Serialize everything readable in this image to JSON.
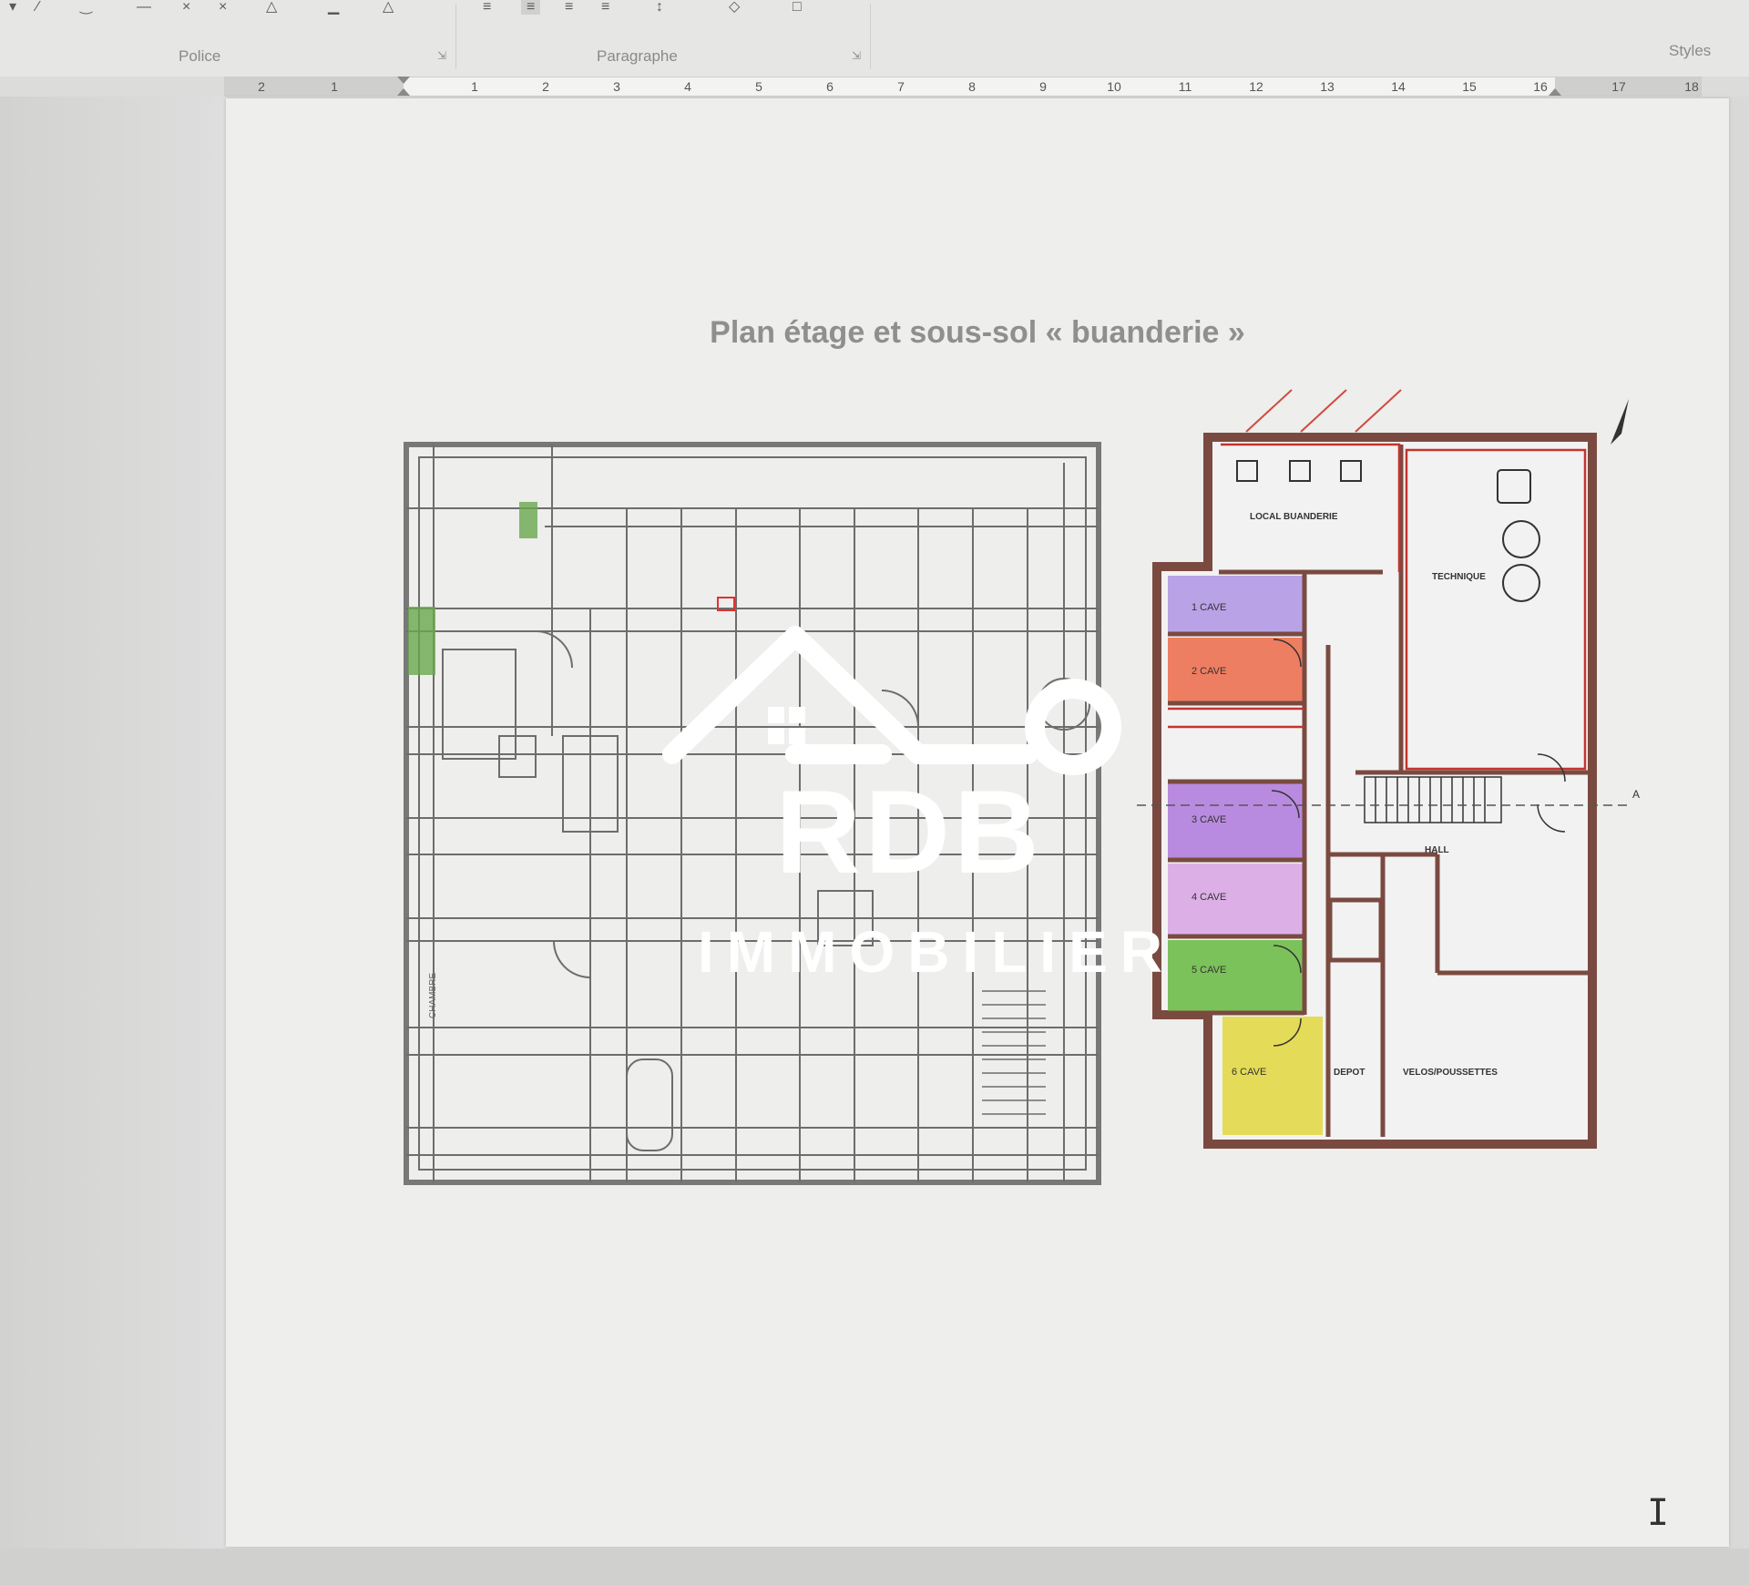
{
  "ribbon": {
    "groups": [
      {
        "label": "Police"
      },
      {
        "label": "Paragraphe"
      },
      {
        "label": "Styles"
      }
    ]
  },
  "ruler": {
    "numbers": [
      "2",
      "1",
      "1",
      "2",
      "3",
      "4",
      "5",
      "6",
      "7",
      "8",
      "9",
      "10",
      "11",
      "12",
      "13",
      "14",
      "15",
      "16",
      "17",
      "18"
    ]
  },
  "document": {
    "title": "Plan étage et sous-sol « buanderie »"
  },
  "watermark": {
    "logo_text": "RDB",
    "subtitle": "IMMOBILIER"
  },
  "plan_labels": {
    "local_buanderie": "LOCAL BUANDERIE",
    "technique": "TECHNIQUE",
    "hall": "HALL",
    "depot": "DEPOT",
    "velos": "VELOS/POUSSETTES",
    "cave1": "1 CAVE",
    "cave2": "2 CAVE",
    "cave3": "3 CAVE",
    "cave4": "4 CAVE",
    "cave5": "5 CAVE",
    "cave6": "6 CAVE",
    "section_mark": "A",
    "chambre": "CHAMBRE"
  },
  "colors": {
    "cave1": "#b9a2e6",
    "cave2": "#ee7e62",
    "cave3": "#b98be0",
    "cave4": "#dcb0e6",
    "cave5": "#7cc25a",
    "cave6": "#e4dc58",
    "wall": "#7a4a40",
    "wall_red": "#c2352e"
  }
}
